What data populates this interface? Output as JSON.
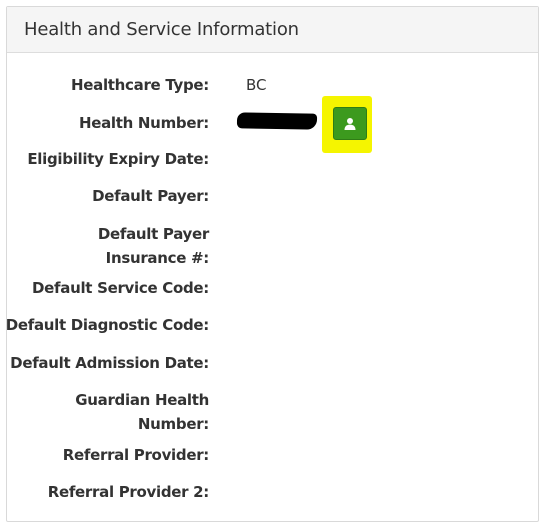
{
  "panel": {
    "title": "Health and Service Information"
  },
  "fields": [
    {
      "label": "Healthcare Type:",
      "value": "BC"
    },
    {
      "label": "Health Number:",
      "value": ""
    },
    {
      "label": "Eligibility Expiry Date:",
      "value": ""
    },
    {
      "label": "Default Payer:",
      "value": ""
    },
    {
      "label": "Default Payer Insurance #:",
      "value": ""
    },
    {
      "label": "Default Service Code:",
      "value": ""
    },
    {
      "label": "Default Diagnostic Code:",
      "value": ""
    },
    {
      "label": "Default Admission Date:",
      "value": ""
    },
    {
      "label": "Guardian Health Number:",
      "value": ""
    },
    {
      "label": "Referral Provider:",
      "value": ""
    },
    {
      "label": "Referral Provider 2:",
      "value": ""
    }
  ],
  "icons": {
    "profile_button": "user-icon"
  },
  "colors": {
    "button_green": "#3c9a1e",
    "highlight_yellow": "#f5f500",
    "redaction": "#000000"
  }
}
